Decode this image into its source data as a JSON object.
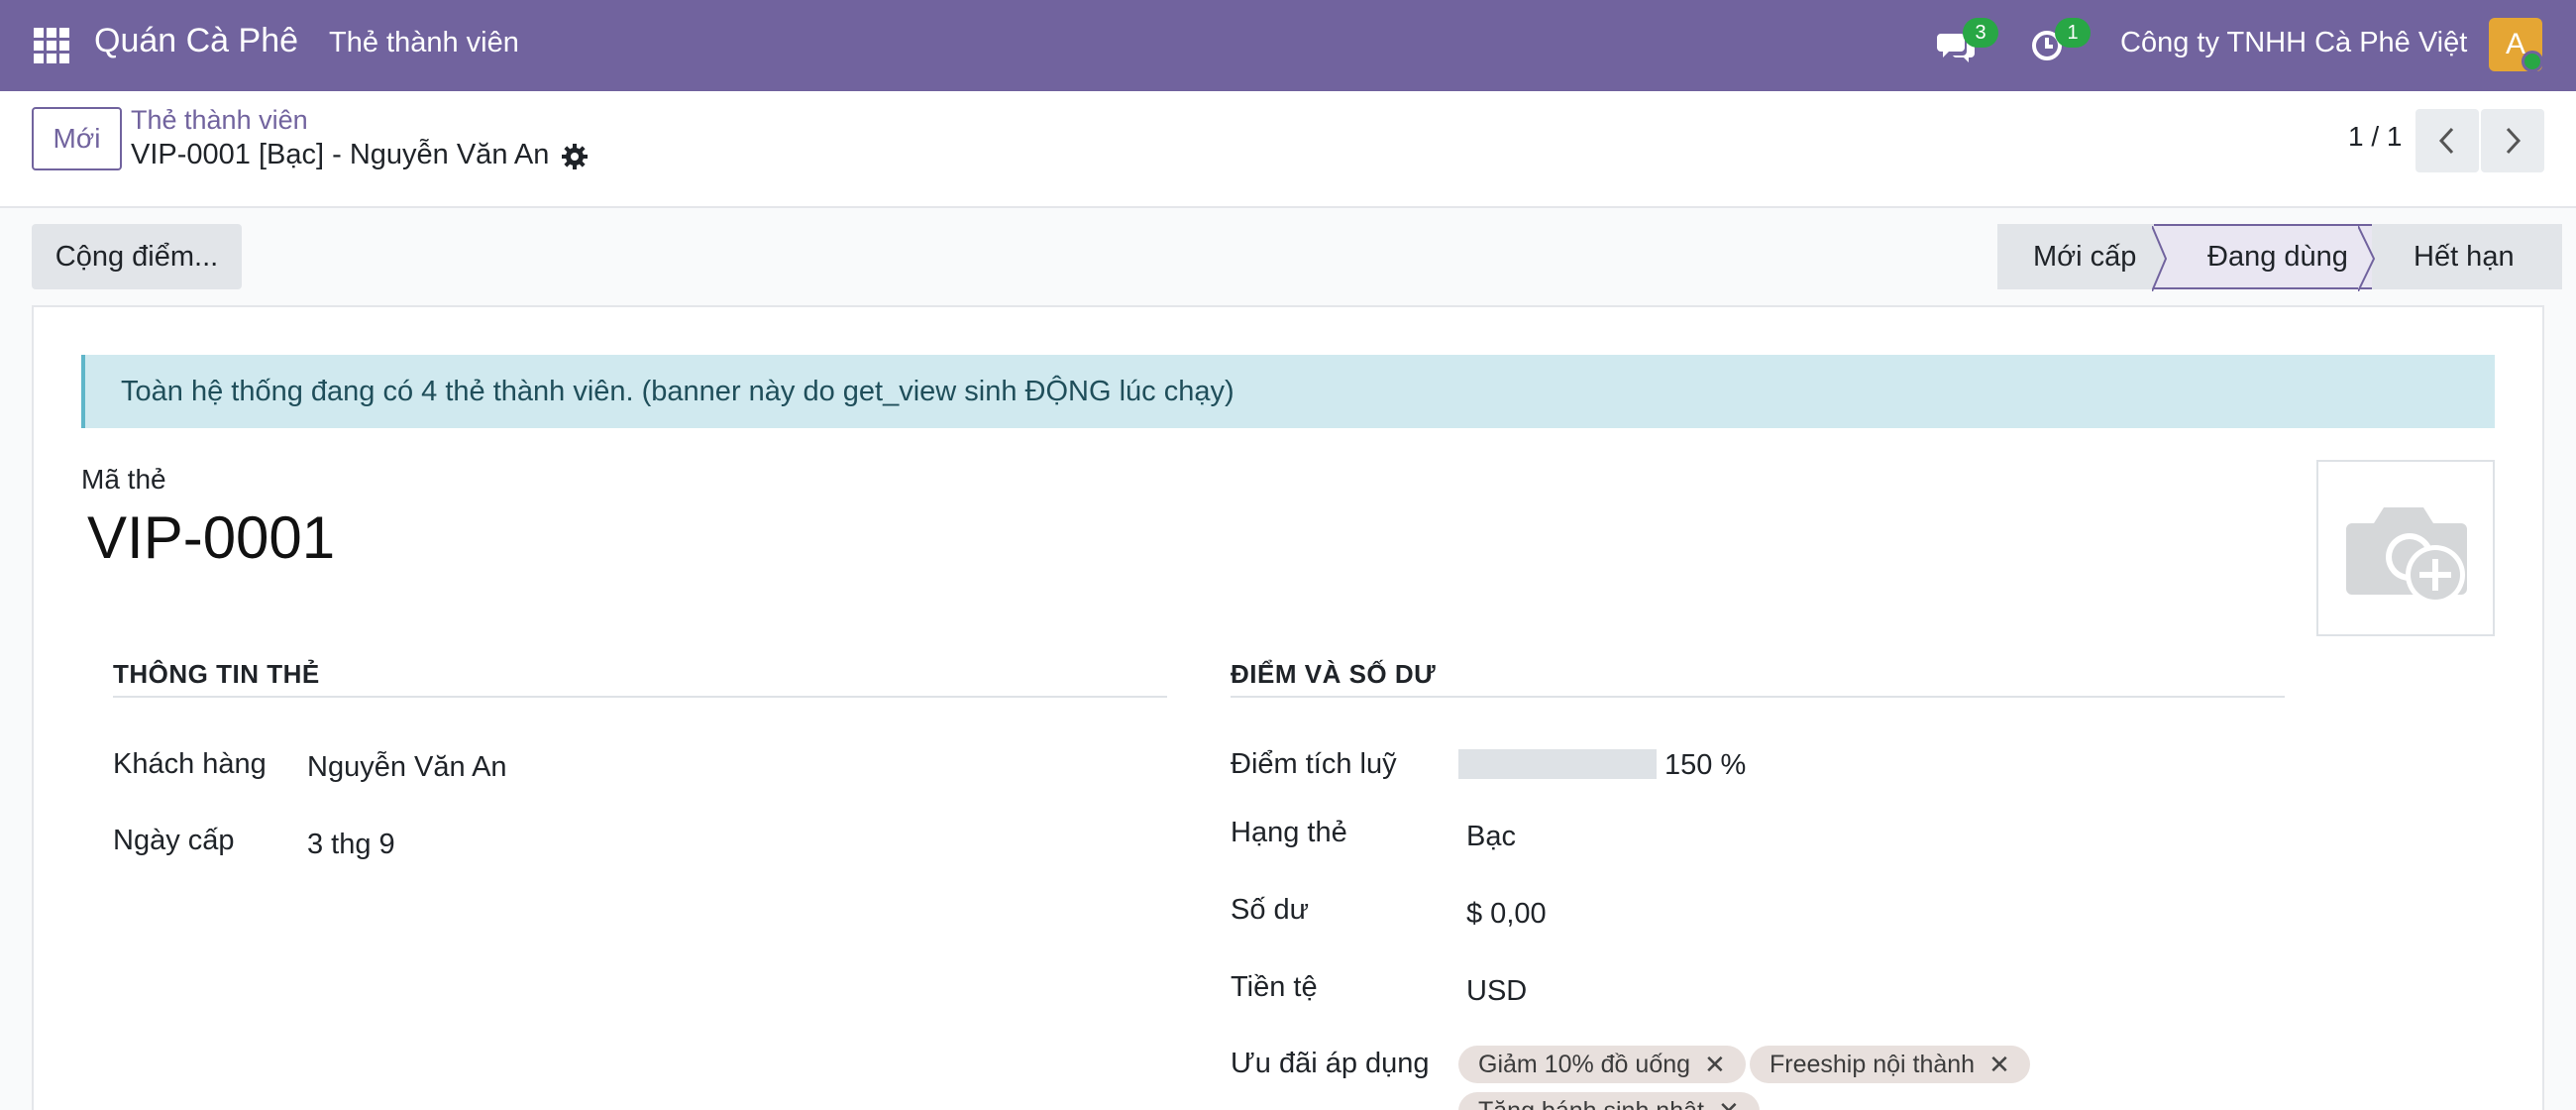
{
  "nav": {
    "app_name": "Quán Cà Phê",
    "menu_label": "Thẻ thành viên",
    "messages_count": "3",
    "activities_count": "1",
    "company": "Công ty TNHH Cà Phê Việt",
    "avatar_letter": "A",
    "accent_color": "#71639e"
  },
  "control": {
    "new_label": "Mới",
    "breadcrumb": "Thẻ thành viên",
    "record_title": "VIP-0001 [Bạc] - Nguyễn Văn An",
    "pager": "1 / 1"
  },
  "actions": {
    "add_points_label": "Cộng điểm..."
  },
  "statusbar": {
    "stages": [
      "Mới cấp",
      "Đang dùng",
      "Hết hạn"
    ],
    "current": "Đang dùng"
  },
  "alert": {
    "text": "Toàn hệ thống đang có 4 thẻ thành viên. (banner này do get_view sinh ĐỘNG lúc chạy)"
  },
  "form": {
    "code_label": "Mã thẻ",
    "code_value": "VIP-0001",
    "left_section": {
      "title": "THÔNG TIN THẺ",
      "fields": [
        {
          "label": "Khách hàng",
          "value": "Nguyễn Văn An"
        },
        {
          "label": "Ngày cấp",
          "value": "3 thg 9"
        }
      ]
    },
    "right_section": {
      "title": "ĐIỂM VÀ SỐ DƯ",
      "points_label": "Điểm tích luỹ",
      "points_progress_text": "150 %",
      "points_progress_fraction": 0,
      "fields": [
        {
          "label": "Hạng thẻ",
          "value": "Bạc"
        },
        {
          "label": "Số dư",
          "value": "$ 0,00"
        },
        {
          "label": "Tiền tệ",
          "value": "USD"
        }
      ],
      "offers_label": "Ưu đãi áp dụng",
      "offers": [
        "Giảm 10% đồ uống",
        "Freeship nội thành",
        "Tặng bánh sinh nhật"
      ]
    }
  }
}
